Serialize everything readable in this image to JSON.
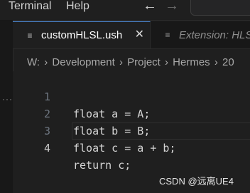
{
  "menubar": {
    "terminal_label": "Terminal",
    "help_label": "Help",
    "back_glyph": "←",
    "forward_glyph": "→"
  },
  "activity_bar": {
    "more_glyph": "···"
  },
  "tabs": [
    {
      "label": "customHLSL.ush",
      "icon_glyph": "≡",
      "active": true,
      "close_glyph": "✕"
    },
    {
      "label": "Extension: HLSL",
      "icon_glyph": "≡",
      "active": false
    }
  ],
  "breadcrumb": {
    "items": [
      "W:",
      "Development",
      "Project",
      "Hermes",
      "20"
    ],
    "separator": "›"
  },
  "editor": {
    "lines": [
      {
        "number": "1",
        "code": "float a = A;"
      },
      {
        "number": "2",
        "code": "float b = B;"
      },
      {
        "number": "3",
        "code": "float c = a + b;"
      },
      {
        "number": "4",
        "code": "return c;"
      }
    ],
    "current_line": "4"
  },
  "watermark": "CSDN @远离UE4",
  "colors": {
    "background": "#1f1f1f",
    "tab_active_border": "#4d8bd8",
    "line_number": "#6e7681",
    "code_text": "#d4d4d4"
  }
}
